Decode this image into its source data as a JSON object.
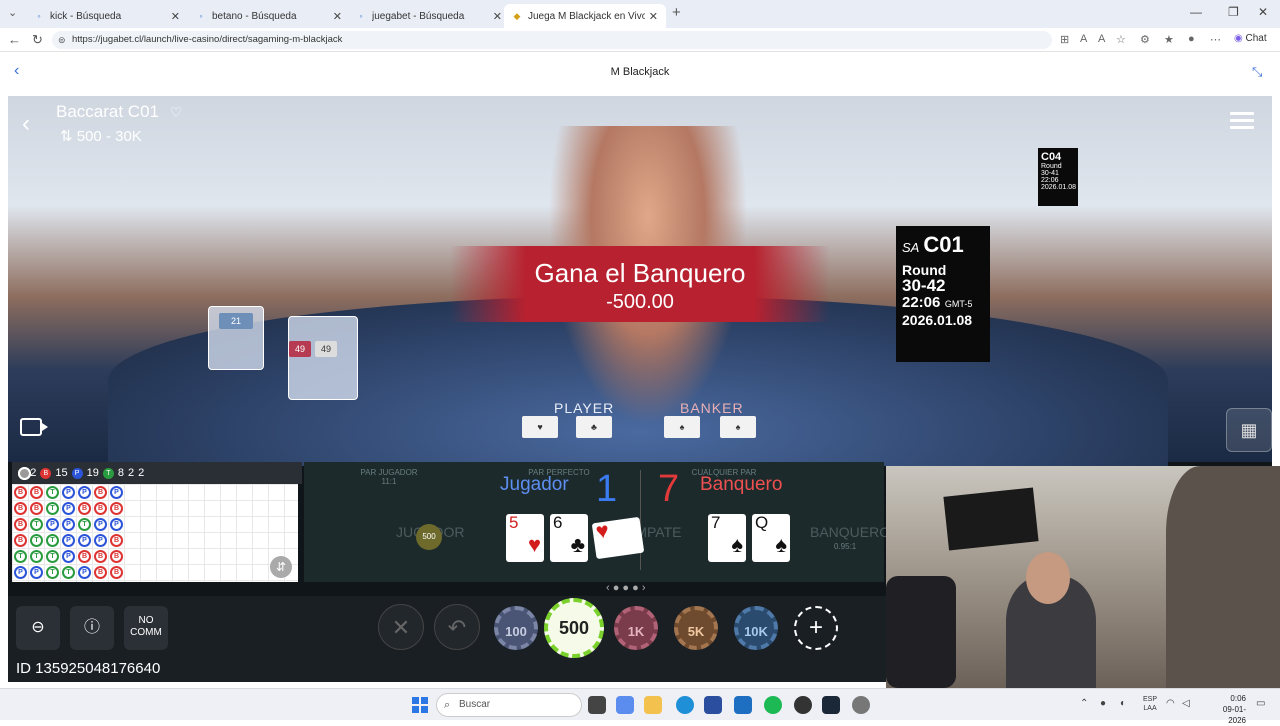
{
  "browser": {
    "tabs": [
      {
        "title": "kick - Búsqueda",
        "active": false
      },
      {
        "title": "betano - Búsqueda",
        "active": false
      },
      {
        "title": "juegabet - Búsqueda",
        "active": false
      },
      {
        "title": "Juega M Blackjack en Vivo de",
        "active": true
      }
    ],
    "url": "https://jugabet.cl/launch/live-casino/direct/sagaming-m-blackjack",
    "chat_label": "Chat"
  },
  "page": {
    "title": "M Blackjack"
  },
  "game": {
    "table_name": "Baccarat C01",
    "limits": "500 - 30K",
    "result_banner": {
      "title": "Gana el Banquero",
      "amount": "-500.00"
    },
    "sign": {
      "table": "C01",
      "brand": "SA",
      "round_label": "Round",
      "round": "30-42",
      "time": "22:06",
      "timezone": "GMT-5",
      "date": "2026.01.08"
    },
    "sign2": {
      "table": "C04",
      "round_label": "Round",
      "round": "30-41",
      "time": "22:06",
      "date": "2026.01.08"
    },
    "shoe_counts": [
      "21",
      "21",
      "49",
      "49"
    ],
    "table_labels": {
      "player": "PLAYER",
      "banker": "BANKER"
    },
    "road_summary": {
      "shoe": "#42",
      "banker": "15",
      "player": "19",
      "tie": "8",
      "banker_pair": "2",
      "player_pair": "2",
      "b_label": "B",
      "p_label": "P",
      "t_label": "T"
    },
    "road_columns": [
      [
        "B",
        "B",
        "B",
        "B",
        "T",
        "P"
      ],
      [
        "B",
        "B",
        "T",
        "T",
        "T",
        "P"
      ],
      [
        "T",
        "T",
        "P",
        "T",
        "T",
        "T"
      ],
      [
        "P",
        "P",
        "P",
        "P",
        "P",
        "T"
      ],
      [
        "P",
        "B",
        "T",
        "P",
        "B",
        "P"
      ],
      [
        "B",
        "B",
        "P",
        "P",
        "B",
        "B"
      ],
      [
        "P",
        "B",
        "P",
        "B",
        "B",
        "B"
      ]
    ],
    "bet_labels": {
      "pair_player": "PAR JUGADOR",
      "pair_player_odds": "11:1",
      "perfect_pair": "PAR PERFECTO",
      "any_pair": "CUALQUIER PAR",
      "player_ghost": "JUGADOR",
      "tie_ghost": "EMPATE",
      "banker_ghost": "BANQUERO",
      "banker_odds": "0.95:1",
      "placed_chip": "500"
    },
    "player": {
      "label": "Jugador",
      "score": "1",
      "cards": [
        {
          "rank": "5",
          "suit": "♥",
          "color": "red"
        },
        {
          "rank": "6",
          "suit": "♣",
          "color": "black"
        },
        {
          "rank": "",
          "suit": "♥",
          "color": "red"
        }
      ]
    },
    "banker": {
      "label": "Banquero",
      "score": "7",
      "cards": [
        {
          "rank": "7",
          "suit": "♠",
          "color": "black"
        },
        {
          "rank": "Q",
          "suit": "♠",
          "color": "black"
        }
      ]
    },
    "controls": {
      "no_comm": "NO COMM",
      "chips": [
        "100",
        "500",
        "1K",
        "5K",
        "10K"
      ],
      "selected_chip": "500",
      "game_id": "ID 135925048176640"
    }
  },
  "taskbar": {
    "search_placeholder": "Buscar",
    "lang": "ESP",
    "lang2": "LAA",
    "time": "0:06",
    "date": "09-01-2026"
  }
}
